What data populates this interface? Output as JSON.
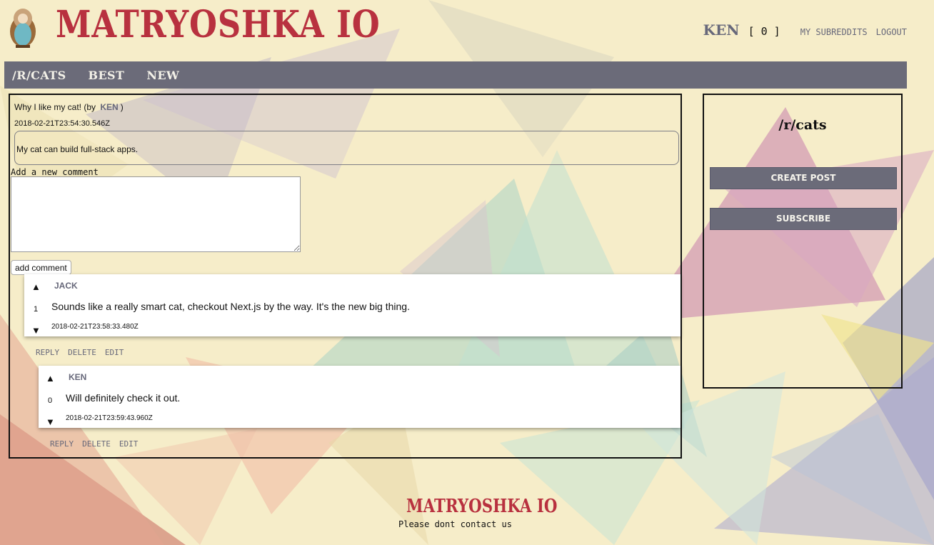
{
  "header": {
    "logo_text": "MATRYOSHKA IO",
    "username": "KEN",
    "karma": "[ 0 ]",
    "links": [
      "MY SUBREDDITS",
      "LOGOUT"
    ]
  },
  "nav": {
    "items": [
      "/R/CATS",
      "BEST",
      "NEW"
    ]
  },
  "post": {
    "title": "Why I like my cat!",
    "by_prefix": "(by",
    "author": "KEN",
    "by_suffix": ")",
    "timestamp": "2018-02-21T23:54:30.546Z",
    "body": "My cat can build full-stack apps.",
    "add_comment_label": "Add a new comment",
    "add_comment_input_value": "",
    "add_comment_button": "add comment"
  },
  "comments": [
    {
      "author": "JACK",
      "score": "1",
      "text": "Sounds like a really smart cat, checkout Next.js by the way. It's the new big thing.",
      "timestamp": "2018-02-21T23:58:33.480Z",
      "actions": [
        "REPLY",
        "DELETE",
        "EDIT"
      ]
    },
    {
      "author": "KEN",
      "score": "0",
      "text": "Will definitely check it out.",
      "timestamp": "2018-02-21T23:59:43.960Z",
      "actions": [
        "REPLY",
        "DELETE",
        "EDIT"
      ]
    }
  ],
  "sidebar": {
    "title": "/r/cats",
    "create_post": "CREATE POST",
    "subscribe": "SUBSCRIBE"
  },
  "footer": {
    "logo_text": "MATRYOSHKA IO",
    "contact_text": "Please dont contact us"
  },
  "icons": {
    "upvote": "up-arrow-icon",
    "downvote": "down-arrow-icon",
    "logo": "matryoshka-doll-icon"
  },
  "colors": {
    "background": "#f6edc9",
    "nav": "#6b6b79",
    "brand": "#b8313f",
    "muted_text": "#67687a"
  }
}
